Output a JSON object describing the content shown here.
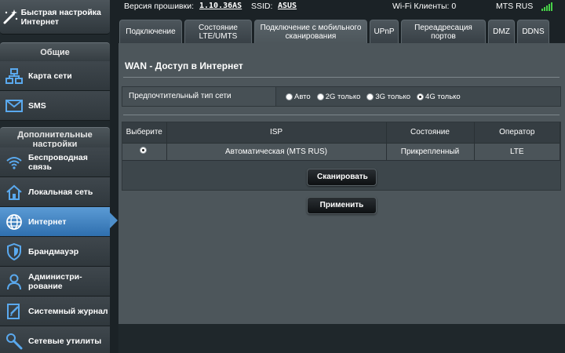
{
  "topbar": {
    "firmware_label": "Версия прошивки:",
    "firmware_value": "1.10.36AS",
    "ssid_label": "SSID:",
    "ssid_value": "ASUS",
    "wifi_clients": "Wi-Fi Клиенты: 0",
    "operator": "MTS RUS"
  },
  "sidebar": {
    "quick_setup": "Быстрая настройка Интернет",
    "general_header": "Общие",
    "general_items": [
      {
        "label": "Карта сети",
        "icon": "network-map-icon"
      },
      {
        "label": "SMS",
        "icon": "envelope-icon"
      }
    ],
    "advanced_header": "Дополнительные настройки",
    "advanced_items": [
      {
        "label": "Беспроводная связь",
        "icon": "wifi-icon"
      },
      {
        "label": "Локальная сеть",
        "icon": "home-icon"
      },
      {
        "label": "Интернет",
        "icon": "globe-icon",
        "active": true
      },
      {
        "label": "Брандмауэр",
        "icon": "shield-icon"
      },
      {
        "label": "Администри-рование",
        "icon": "user-icon"
      },
      {
        "label": "Системный журнал",
        "icon": "log-icon"
      },
      {
        "label": "Сетевые утилиты",
        "icon": "tools-icon"
      }
    ]
  },
  "tabs": [
    {
      "label": "Подключение"
    },
    {
      "label": "Состояние LTE/UMTS"
    },
    {
      "label": "Подключение с мобильного сканирования",
      "active": true
    },
    {
      "label": "UPnP"
    },
    {
      "label": "Переадресация портов"
    },
    {
      "label": "DMZ"
    },
    {
      "label": "DDNS"
    }
  ],
  "main": {
    "title": "WAN - Доступ в Интернет",
    "network_type_label": "Предпочтительный тип сети",
    "network_options": [
      {
        "label": "Авто",
        "selected": false
      },
      {
        "label": "2G только",
        "selected": false
      },
      {
        "label": "3G только",
        "selected": false
      },
      {
        "label": "4G только",
        "selected": true
      }
    ],
    "table_headers": [
      "Выберите",
      "ISP",
      "Состояние",
      "Оператор"
    ],
    "table_rows": [
      {
        "isp": "Автоматическая (MTS RUS)",
        "status": "Прикрепленный",
        "operator": "LTE",
        "selected": true
      }
    ],
    "scan_button": "Сканировать",
    "apply_button": "Применить"
  },
  "colors": {
    "active_nav": "#3f83c5",
    "panel_bg": "#4d565b",
    "page_bg": "#1b2226",
    "signal": "#47d147"
  }
}
